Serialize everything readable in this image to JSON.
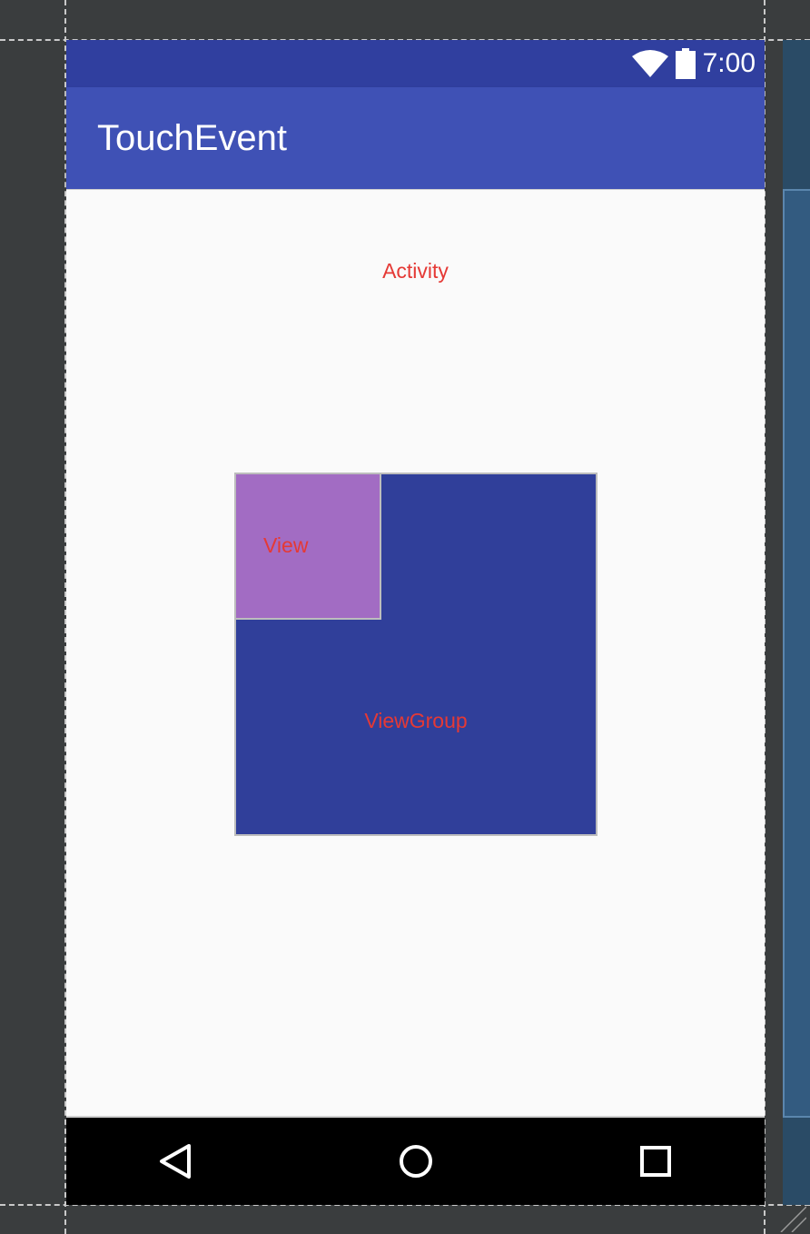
{
  "status_bar": {
    "time": "7:00",
    "icons": [
      "wifi-icon",
      "battery-icon"
    ]
  },
  "app_bar": {
    "title": "TouchEvent"
  },
  "content": {
    "activity_label": "Activity",
    "viewgroup_label": "ViewGroup",
    "view_label": "View"
  },
  "nav_bar": {
    "buttons": [
      "back-icon",
      "home-icon",
      "recents-icon"
    ]
  },
  "colors": {
    "status_bar": "#303f9f",
    "app_bar": "#3f51b5",
    "viewgroup": "#303f9a",
    "view": "#a26cc3",
    "label_text": "#e53935",
    "content_background": "#fafafa"
  }
}
